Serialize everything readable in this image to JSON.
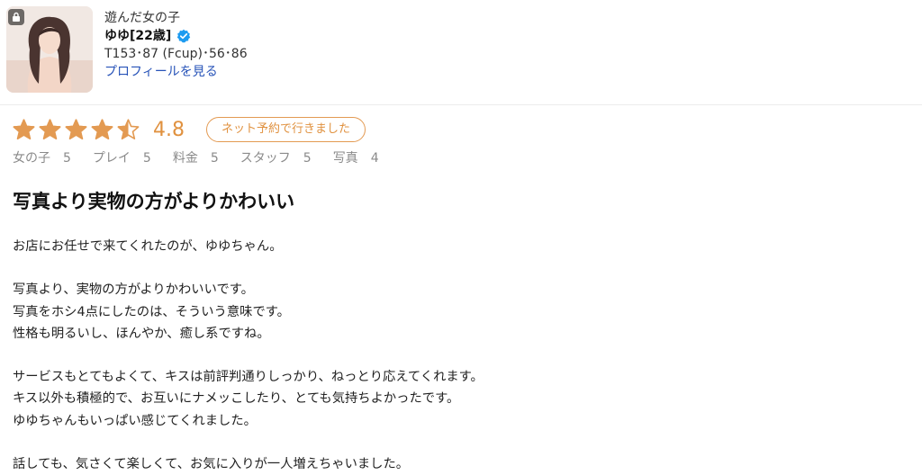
{
  "profile": {
    "label": "遊んだ女の子",
    "name": "ゆゆ[22歳]",
    "stats": "T153･87 (Fcup)･56･86",
    "link_text": "プロフィールを見る"
  },
  "rating": {
    "stars": 4.5,
    "score": "4.8",
    "booking_badge": "ネット予約で行きました",
    "breakdown": [
      {
        "label": "女の子",
        "value": "5"
      },
      {
        "label": "プレイ",
        "value": "5"
      },
      {
        "label": "料金",
        "value": "5"
      },
      {
        "label": "スタッフ",
        "value": "5"
      },
      {
        "label": "写真",
        "value": "4"
      }
    ]
  },
  "review": {
    "title": "写真より実物の方がよりかわいい",
    "lines": [
      "お店にお任せで来てくれたのが、ゆゆちゃん。",
      "",
      "写真より、実物の方がよりかわいいです。",
      "写真をホシ4点にしたのは、そういう意味です。",
      "性格も明るいし、ほんやか、癒し系ですね。",
      "",
      "サービスもとてもよくて、キスは前評判通りしっかり、ねっとり応えてくれます。",
      "キス以外も積極的で、お互いにナメッこしたり、とても気持ちよかったです。",
      "ゆゆちゃんもいっぱい感じてくれました。",
      "",
      "話しても、気さくて楽しくて、お気に入りが一人増えちゃいました。"
    ]
  },
  "colors": {
    "accent": "#e0913f",
    "star": "#e39a52",
    "link": "#2753b8",
    "verified": "#1d9bf0"
  },
  "icons": {
    "lock": "lock-icon",
    "verified": "verified-badge-icon",
    "star": "star-icon"
  }
}
